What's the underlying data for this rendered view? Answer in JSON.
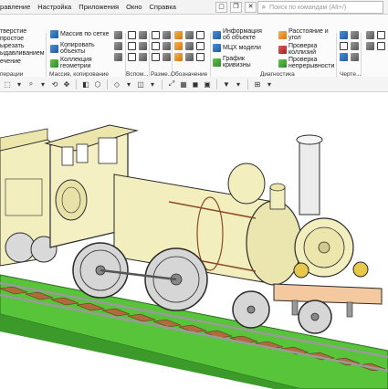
{
  "menubar": {
    "items": [
      "правление",
      "Настройка",
      "Приложения",
      "Окно",
      "Справка"
    ],
    "search_placeholder": "Поиск по командам (Alt+/)"
  },
  "ribbon": {
    "groups": [
      {
        "label": "перации",
        "buttons": [
          "тверстие простое",
          "ырезать ыдавливанием",
          "ечение"
        ]
      },
      {
        "label": "Массив, копирование",
        "buttons": [
          "Массив по сетке",
          "Копировать объекты",
          "Коллекция геометрии"
        ]
      },
      {
        "label": "Вспом...",
        "buttons": []
      },
      {
        "label": "Разме...",
        "buttons": []
      },
      {
        "label": "Обозначение",
        "buttons": []
      },
      {
        "label": "Диагностика",
        "buttons": [
          "Информация об объекте",
          "МЦХ модели",
          "График кривизны",
          "Расстояние и угол",
          "Проверка коллизий",
          "Проверка непрерывности"
        ]
      },
      {
        "label": "Черте...",
        "buttons": []
      }
    ]
  },
  "colors": {
    "model_body": "#f3eebd",
    "model_outline": "#2a2a2a",
    "track_grass": "#57c43a",
    "track_sleeper": "#b06a3d",
    "rail": "#9a9a9a"
  }
}
